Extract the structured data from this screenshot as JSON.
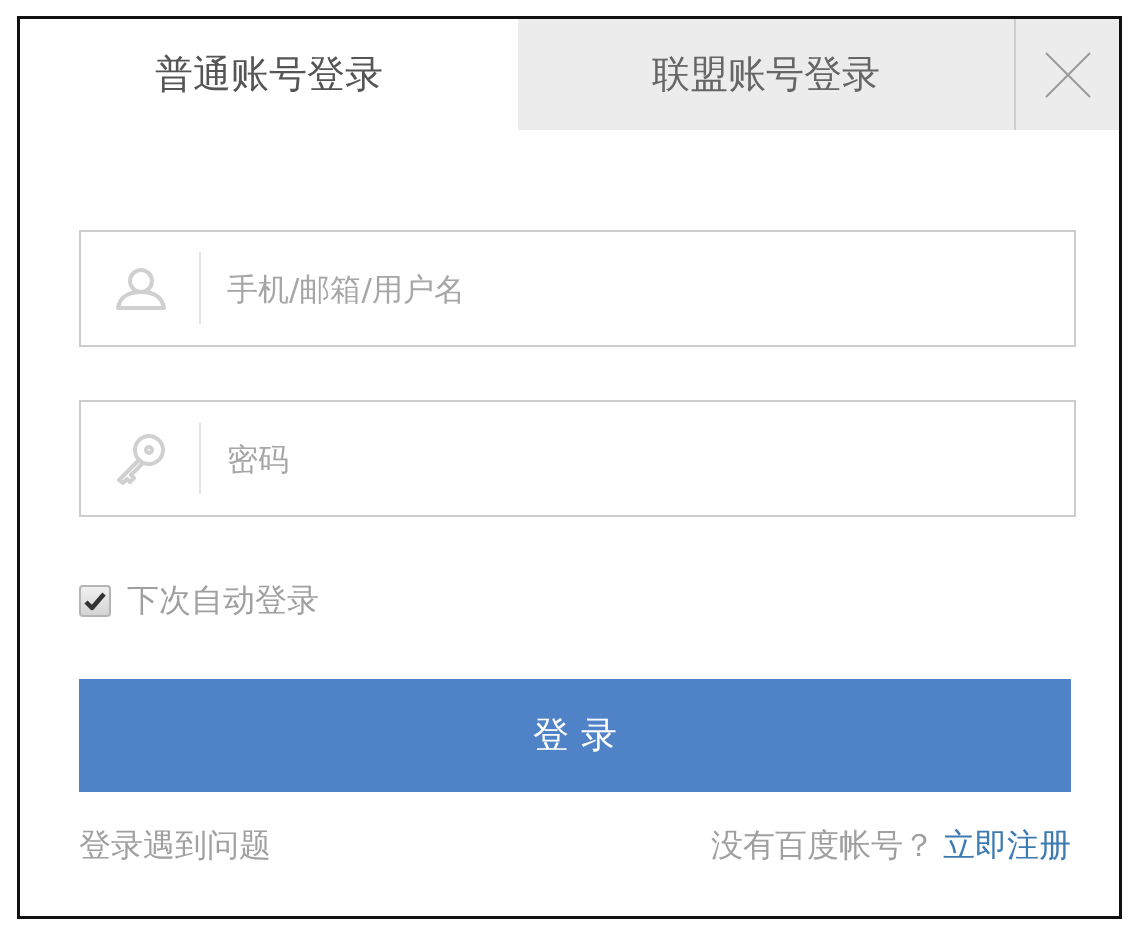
{
  "tabs": [
    {
      "label": "普通账号登录",
      "selected": true
    },
    {
      "label": "联盟账号登录",
      "selected": false
    }
  ],
  "fields": [
    {
      "kind": "user",
      "placeholder": "手机/邮箱/用户名"
    },
    {
      "kind": "password",
      "placeholder": "密码"
    }
  ],
  "remember": {
    "label": "下次自动登录",
    "checked": true
  },
  "login_button": {
    "label": "登 录"
  },
  "footer": {
    "help_link": "登录遇到问题",
    "register_prompt": "没有百度帐号？",
    "register_link": "立即注册"
  }
}
